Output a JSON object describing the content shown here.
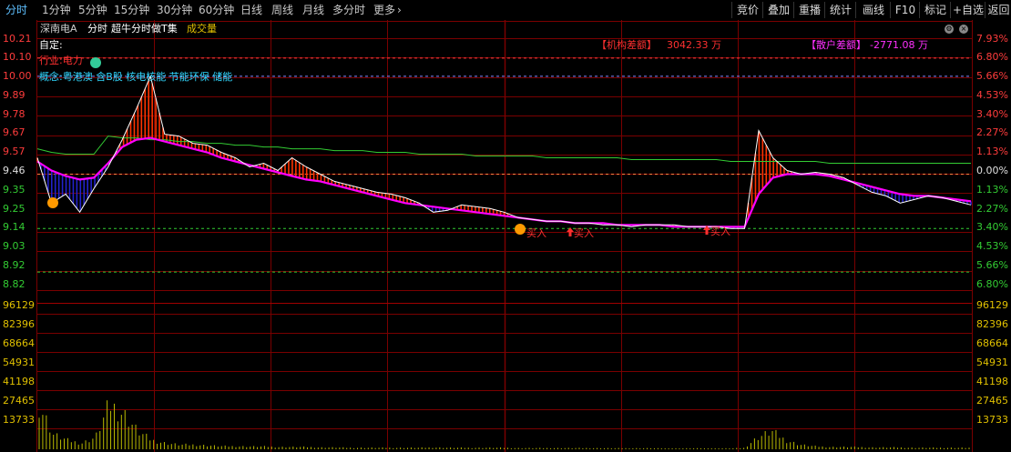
{
  "period_tabs": [
    "分时",
    "1分钟",
    "5分钟",
    "15分钟",
    "30分钟",
    "60分钟",
    "日线",
    "周线",
    "月线",
    "多分时",
    "更多"
  ],
  "toolbar_right": [
    "竞价",
    "叠加",
    "重播",
    "统计",
    "画线",
    "F10",
    "标记",
    "+自选",
    "返回"
  ],
  "header": {
    "stock_name": "深南电A",
    "mode": "分时",
    "indicator": "超牛分时做T集",
    "volume_label": "成交量"
  },
  "overlay": {
    "custom_label": "自定:",
    "industry_label": "行业:电力",
    "concept_label": "概念:粤港澳 含B股 核电核能 节能环保 储能",
    "inst_label": "【机构差额】",
    "inst_value": "3042.33 万",
    "retail_label": "【散户差额】",
    "retail_value": "-2771.08 万",
    "buy_label": "买入"
  },
  "price_axis_left": [
    "10.21",
    "10.10",
    "10.00",
    "9.89",
    "9.78",
    "9.67",
    "9.57",
    "9.46",
    "9.35",
    "9.25",
    "9.14",
    "9.03",
    "8.92",
    "8.82"
  ],
  "price_axis_right": [
    "7.93%",
    "6.80%",
    "5.66%",
    "4.53%",
    "3.40%",
    "2.27%",
    "1.13%",
    "0.00%",
    "1.13%",
    "2.27%",
    "3.40%",
    "4.53%",
    "5.66%",
    "6.80%"
  ],
  "volume_axis": [
    "96129",
    "82396",
    "68664",
    "54931",
    "41198",
    "27465",
    "13733"
  ],
  "colors": {
    "grid": "#7a0000",
    "price_line": "#ffffff",
    "avg_line": "#ff00ff",
    "green_line": "#33cc33",
    "fill_up": "#ff3300",
    "fill_down": "#2222cc",
    "volume": "#bbbb00",
    "axis_up": "#ff3c3c",
    "axis_down": "#33cc33"
  },
  "chart_data": {
    "type": "line",
    "ylim": [
      8.82,
      10.21
    ],
    "prev_close": 9.46,
    "price": [
      9.55,
      9.3,
      9.35,
      9.25,
      9.38,
      9.5,
      9.65,
      9.82,
      10.0,
      9.68,
      9.67,
      9.63,
      9.62,
      9.58,
      9.55,
      9.5,
      9.52,
      9.48,
      9.55,
      9.5,
      9.46,
      9.42,
      9.4,
      9.38,
      9.36,
      9.35,
      9.33,
      9.3,
      9.25,
      9.26,
      9.29,
      9.28,
      9.27,
      9.25,
      9.22,
      9.21,
      9.2,
      9.2,
      9.19,
      9.19,
      9.18,
      9.18,
      9.17,
      9.18,
      9.18,
      9.18,
      9.17,
      9.17,
      9.17,
      9.16,
      9.16,
      9.7,
      9.55,
      9.48,
      9.46,
      9.47,
      9.46,
      9.44,
      9.4,
      9.36,
      9.34,
      9.3,
      9.32,
      9.34,
      9.33,
      9.31,
      9.29
    ],
    "avg": [
      9.53,
      9.48,
      9.45,
      9.43,
      9.44,
      9.52,
      9.61,
      9.65,
      9.66,
      9.64,
      9.62,
      9.6,
      9.58,
      9.55,
      9.53,
      9.51,
      9.49,
      9.47,
      9.45,
      9.43,
      9.42,
      9.4,
      9.38,
      9.36,
      9.34,
      9.32,
      9.3,
      9.29,
      9.28,
      9.27,
      9.26,
      9.25,
      9.24,
      9.23,
      9.22,
      9.21,
      9.2,
      9.2,
      9.19,
      9.19,
      9.19,
      9.18,
      9.18,
      9.18,
      9.18,
      9.17,
      9.17,
      9.17,
      9.17,
      9.17,
      9.17,
      9.35,
      9.44,
      9.46,
      9.46,
      9.46,
      9.45,
      9.43,
      9.41,
      9.39,
      9.37,
      9.35,
      9.34,
      9.34,
      9.33,
      9.32,
      9.31
    ],
    "green_line": [
      9.6,
      9.58,
      9.57,
      9.57,
      9.57,
      9.67,
      9.66,
      9.66,
      9.65,
      9.65,
      9.64,
      9.64,
      9.63,
      9.63,
      9.62,
      9.62,
      9.61,
      9.61,
      9.6,
      9.6,
      9.6,
      9.59,
      9.59,
      9.59,
      9.58,
      9.58,
      9.58,
      9.57,
      9.57,
      9.57,
      9.57,
      9.56,
      9.56,
      9.56,
      9.56,
      9.56,
      9.55,
      9.55,
      9.55,
      9.55,
      9.55,
      9.55,
      9.54,
      9.54,
      9.54,
      9.54,
      9.54,
      9.54,
      9.54,
      9.53,
      9.53,
      9.53,
      9.53,
      9.53,
      9.53,
      9.53,
      9.52,
      9.52,
      9.52,
      9.52,
      9.52,
      9.52,
      9.52,
      9.52,
      9.52,
      9.52,
      9.52
    ],
    "dashed_levels": [
      {
        "price": 10.1,
        "color": "#ff4040"
      },
      {
        "price": 10.0,
        "color": "#8888ff"
      },
      {
        "price": 9.46,
        "color": "#ff8040"
      },
      {
        "price": 9.16,
        "color": "#33cc33"
      },
      {
        "price": 8.92,
        "color": "#33cc33"
      }
    ],
    "volume": [
      30000,
      10000,
      6000,
      4000,
      8000,
      30000,
      24000,
      12000,
      6000,
      4000,
      3000,
      3000,
      2500,
      2000,
      2000,
      1800,
      1800,
      1500,
      1500,
      1500,
      1200,
      1200,
      1000,
      1000,
      1000,
      1000,
      1000,
      1000,
      1200,
      1000,
      1000,
      1000,
      1000,
      1000,
      800,
      800,
      800,
      800,
      800,
      800,
      700,
      700,
      700,
      700,
      600,
      600,
      600,
      600,
      600,
      600,
      800,
      8000,
      12000,
      6000,
      3000,
      2000,
      1500,
      1500,
      1500,
      1200,
      1200,
      1200,
      1000,
      1000,
      1000,
      1000,
      1000
    ],
    "volume_ylim": [
      0,
      96129
    ]
  }
}
